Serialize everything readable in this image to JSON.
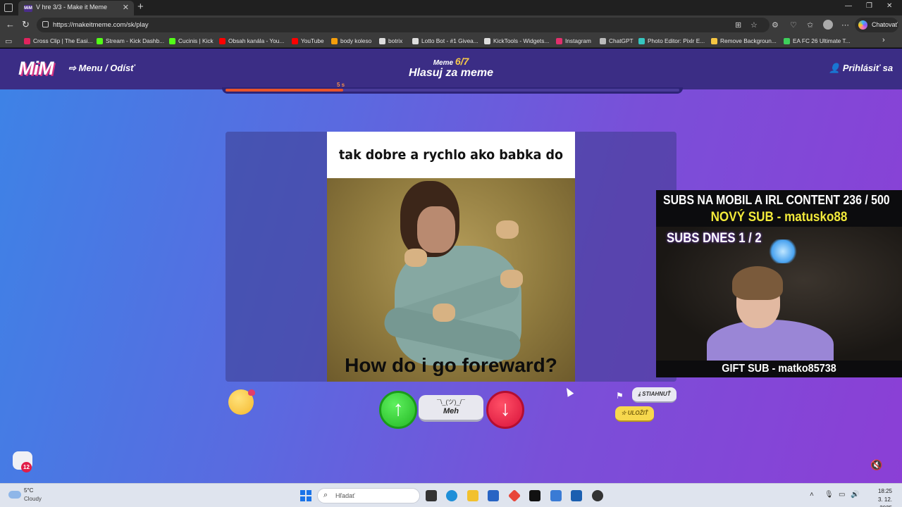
{
  "browser": {
    "tab_title": "V hre 3/3 - Make it Meme",
    "tab_favicon": "MiM",
    "url": "https://makeitmeme.com/sk/play",
    "copilot_label": "Chatovať"
  },
  "bookmarks": [
    {
      "label": "Cross Clip | The Easi...",
      "color": "#e0245e"
    },
    {
      "label": "Stream - Kick Dashb...",
      "color": "#53fc18"
    },
    {
      "label": "Cucinis | Kick",
      "color": "#53fc18"
    },
    {
      "label": "Obsah kanála - You...",
      "color": "#ff0000"
    },
    {
      "label": "YouTube",
      "color": "#ff0000"
    },
    {
      "label": "body koleso",
      "color": "#f59e0b"
    },
    {
      "label": "botrix",
      "color": "#dddddd"
    },
    {
      "label": "Lotto Bot - #1 Givea...",
      "color": "#dddddd"
    },
    {
      "label": "KickTools - Widgets...",
      "color": "#dddddd"
    },
    {
      "label": "Instagram",
      "color": "#e1306c"
    },
    {
      "label": "ChatGPT",
      "color": "#bbbbbb"
    },
    {
      "label": "Photo Editor: Pixlr E...",
      "color": "#36c6c0"
    },
    {
      "label": "Remove Backgroun...",
      "color": "#f5c542"
    },
    {
      "label": "EA FC 26 Ultimate T...",
      "color": "#3ecf5b"
    }
  ],
  "header": {
    "logo": "MiM",
    "menu_label": "Menu / Odísť",
    "round_prefix": "Meme",
    "round_current": "6",
    "round_total": "/7",
    "round_title": "Hlasuj za meme",
    "login_label": "Prihlásiť sa"
  },
  "timer": {
    "label": "5 s",
    "progress": 0.26
  },
  "meme": {
    "top_text": "tak dobre a rychlo ako babka do kostola",
    "bottom_text": "How do i go foreward?"
  },
  "vote": {
    "up_symbol": "↑",
    "down_symbol": "↓",
    "meh_shrug": "¯\\_(ツ)_/¯",
    "meh_label": "Meh"
  },
  "actions": {
    "download_label": "STIAHNUŤ",
    "save_label": "ULOŽIŤ"
  },
  "chat": {
    "badge_count": "12"
  },
  "overlay": {
    "line1": "SUBS NA MOBIL A IRL CONTENT  236 / 500",
    "line2": "NOVÝ SUB - matusko88",
    "line3": "SUBS DNES  1 / 2",
    "bottom": "GIFT SUB - matko85738"
  },
  "taskbar": {
    "temperature": "5°C",
    "condition": "Cloudy",
    "search_placeholder": "Hľadať",
    "time": "18:25",
    "date": "3. 12. 2025"
  },
  "colors": {
    "header_bg": "#3b2d85",
    "accent_orange": "#e8542a",
    "vote_up": "#23b823",
    "vote_down": "#d8123a",
    "round_highlight": "#f7c948"
  }
}
